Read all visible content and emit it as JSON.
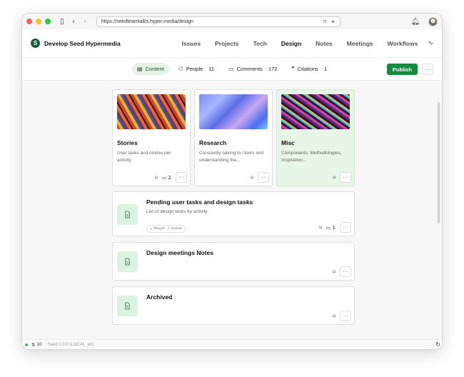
{
  "browser": {
    "url": "https://seedteamtalks.hyper.media/design",
    "traffic_lights": [
      "#ff5f57",
      "#febc2e",
      "#28c840"
    ]
  },
  "site": {
    "logo_letter": "S",
    "name": "Develop Seed Hypermedia"
  },
  "nav": {
    "items": [
      "Issues",
      "Projects",
      "Tech",
      "Design",
      "Notes",
      "Meetings",
      "Workflows"
    ],
    "active": "Design"
  },
  "tabs": [
    {
      "label": "Content",
      "count": ""
    },
    {
      "label": "People",
      "count": "11"
    },
    {
      "label": "Comments",
      "count": "172"
    },
    {
      "label": "Citations",
      "count": "1"
    }
  ],
  "actions": {
    "publish_label": "Publish",
    "more_label": "···"
  },
  "cards": [
    {
      "title": "Stories",
      "desc": "User tasks and stories per activity",
      "comments": "2"
    },
    {
      "title": "Research",
      "desc": "Constantly talking to Users and understanding the...",
      "comments": ""
    },
    {
      "title": "Misc",
      "desc": "Components, Methodologies, Inspiration...",
      "comments": ""
    }
  ],
  "rows": [
    {
      "title": "Pending user tasks and design tasks",
      "desc": "List of design tasks by activity",
      "badge": "Merged · 2 versions",
      "comments": "1"
    },
    {
      "title": "Design meetings Notes",
      "desc": "",
      "badge": "",
      "comments": ""
    },
    {
      "title": "Archived",
      "desc": "",
      "badge": "",
      "comments": ""
    }
  ],
  "status": {
    "peers": "10",
    "version": "Seed 0.0.0 (LOCAL_ab)"
  }
}
